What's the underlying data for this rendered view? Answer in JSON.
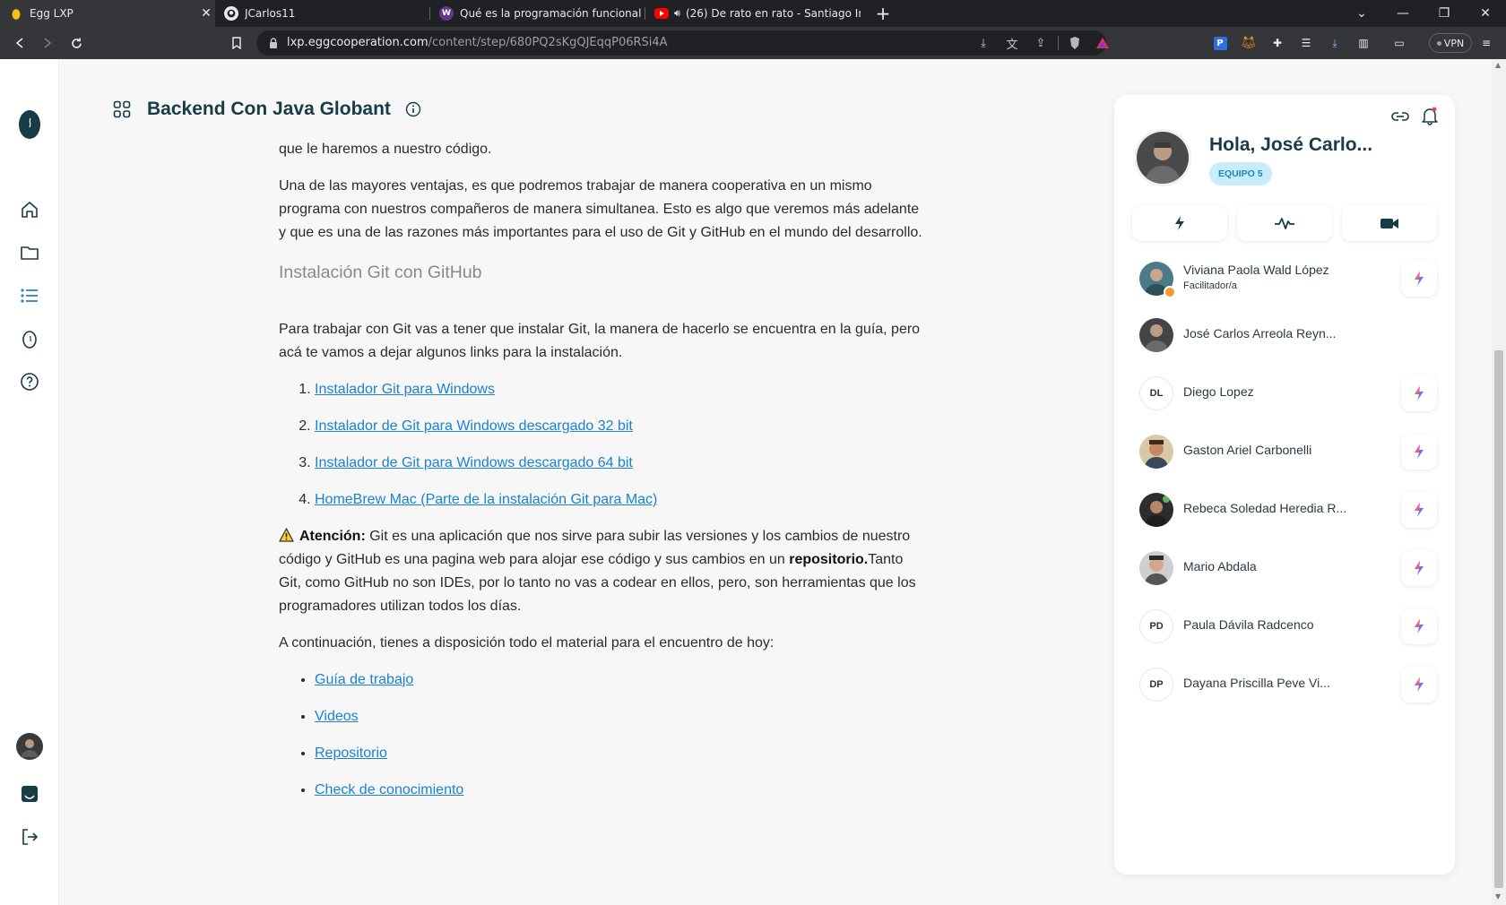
{
  "browser": {
    "tabs": [
      {
        "title": "Egg LXP",
        "active": true
      },
      {
        "title": "JCarlos11",
        "active": false
      },
      {
        "title": "Qué es la programación funcional y ca",
        "active": false
      },
      {
        "title": "(26) De rato en rato - Santiago Ins",
        "active": false
      }
    ],
    "url_host": "lxp.eggcooperation.com",
    "url_path": "/content/step/680PQ2sKgQJEqqP06RSi4A",
    "vpn_label": "VPN"
  },
  "course": {
    "title": "Backend Con Java Globant"
  },
  "article": {
    "p_intro": "que le haremos a nuestro código.",
    "p_cooperative": "Una de las mayores ventajas, es que podremos trabajar de manera cooperativa en un mismo programa con nuestros compañeros de manera simultanea. Esto es algo que veremos más adelante y que es una de las razones más importantes para el uso de Git y GitHub en el mundo del desarrollo.",
    "heading_install": "Instalación Git con GitHub",
    "p_install": "Para trabajar con Git vas a tener que instalar Git, la manera de hacerlo se encuentra en la guía, pero acá te vamos a dejar algunos links para la instalación.",
    "install_links": [
      "Instalador Git para Windows",
      "Instalador de Git para Windows descargado 32 bit",
      "Instalador de Git para Windows descargado 64 bit",
      "HomeBrew Mac (Parte de la instalación Git para Mac)"
    ],
    "attention_label": "Atención:",
    "attention_text_1": " Git es una aplicación que nos sirve para subir las versiones y los cambios de nuestro código y GitHub es una pagina web para alojar ese código y sus cambios en un ",
    "attention_bold_2": "repositorio.",
    "attention_text_3": "Tanto Git, como GitHub no son IDEs, por lo tanto no vas a codear en ellos, pero, son herramientas que los programadores utilizan todos los días.",
    "p_material": "A continuación, tienes a disposición todo el material para el encuentro de hoy:",
    "material_links": [
      "Guía de trabajo",
      "Videos",
      "Repositorio",
      "Check de conocimiento"
    ]
  },
  "panel": {
    "greeting": "Hola, José Carlo...",
    "team_badge": "EQUIPO 5",
    "members": [
      {
        "name": "Viviana Paola Wald López",
        "role": "Facilitador/a",
        "initials": "",
        "has_bolt": true
      },
      {
        "name": "José Carlos Arreola Reyn...",
        "role": "",
        "initials": "",
        "has_bolt": false
      },
      {
        "name": "Diego Lopez",
        "role": "",
        "initials": "DL",
        "has_bolt": true
      },
      {
        "name": "Gaston Ariel Carbonelli",
        "role": "",
        "initials": "",
        "has_bolt": true
      },
      {
        "name": "Rebeca Soledad Heredia R...",
        "role": "",
        "initials": "",
        "has_bolt": true
      },
      {
        "name": "Mario Abdala",
        "role": "",
        "initials": "",
        "has_bolt": true
      },
      {
        "name": "Paula Dávila Radcenco",
        "role": "",
        "initials": "PD",
        "has_bolt": true
      },
      {
        "name": "Dayana Priscilla Peve Vi...",
        "role": "",
        "initials": "DP",
        "has_bolt": true
      }
    ]
  },
  "colors": {
    "brand_dark": "#173c46",
    "link": "#1a82d3",
    "badge_bg": "#c9ecfb",
    "bolt": "#5b7bf0"
  }
}
